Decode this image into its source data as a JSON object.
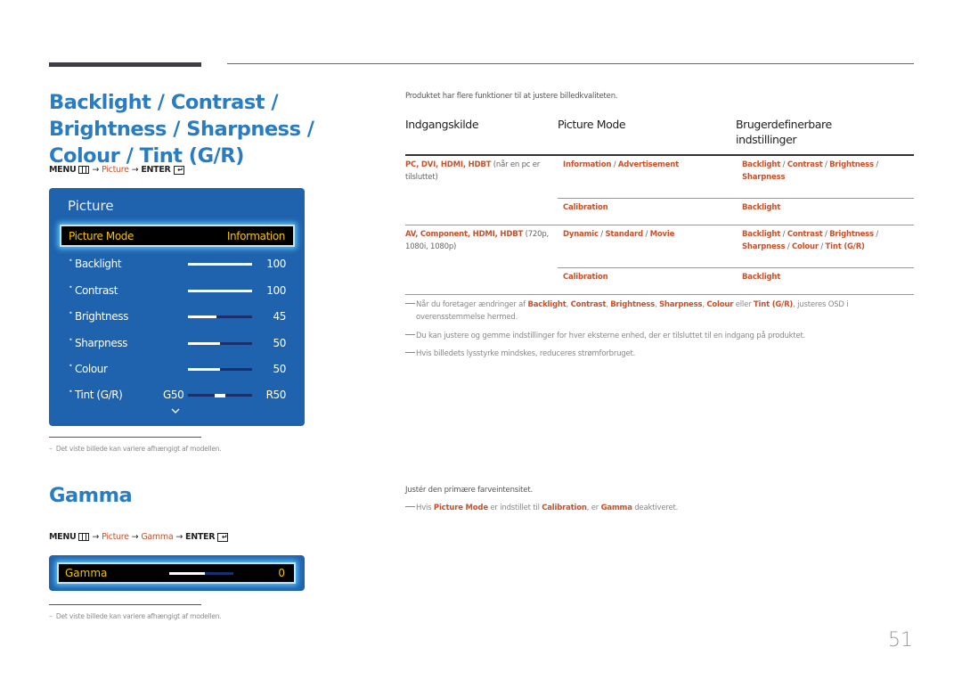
{
  "section1": {
    "title": "Backlight / Contrast / Brightness / Sharpness / Colour / Tint (G/R)",
    "menu_path": {
      "menu": "MENU",
      "arrow": "→",
      "picture": "Picture",
      "enter": "ENTER"
    },
    "osd": {
      "title": "Picture",
      "selected_label": "Picture Mode",
      "selected_value": "Information",
      "rows": [
        {
          "label": "Backlight",
          "value": "100",
          "level": 1.0
        },
        {
          "label": "Contrast",
          "value": "100",
          "level": 1.0
        },
        {
          "label": "Brightness",
          "value": "45",
          "level": 0.45
        },
        {
          "label": "Sharpness",
          "value": "50",
          "level": 0.5
        },
        {
          "label": "Colour",
          "value": "50",
          "level": 0.5
        },
        {
          "label": "Tint (G/R)",
          "green_value": "G50",
          "value": "R50",
          "level": 0.5
        }
      ],
      "scroll_icon": "chevron-down-icon"
    },
    "footnote": "Det viste billede kan variere afhængigt af modellen.",
    "intro": "Produktet har flere funktioner til at justere billedkvaliteten.",
    "table": {
      "headers": [
        "Indgangskilde",
        "Picture Mode",
        "Brugerdefinerbare indstillinger"
      ],
      "rows": [
        {
          "source_bold": "PC, DVI, HDMI, HDBT",
          "source_plain": " (når en pc er tilsluttet)",
          "modes": [
            "Information",
            "Advertisement"
          ],
          "settings": [
            "Backlight",
            "Contrast",
            "Brightness",
            "Sharpness"
          ],
          "calibration_mode": "Calibration",
          "calibration_setting": "Backlight"
        },
        {
          "source_bold": "AV, Component, HDMI, HDBT",
          "source_plain": " (720p, 1080i, 1080p)",
          "modes": [
            "Dynamic",
            "Standard",
            "Movie"
          ],
          "settings": [
            "Backlight",
            "Contrast",
            "Brightness",
            "Sharpness",
            "Colour",
            "Tint (G/R)"
          ],
          "calibration_mode": "Calibration",
          "calibration_setting": "Backlight"
        }
      ]
    },
    "notes": {
      "n1_pre": "Når du foretager ændringer af ",
      "n1_terms": [
        "Backlight",
        "Contrast",
        "Brightness",
        "Sharpness",
        "Colour"
      ],
      "n1_or": " eller ",
      "n1_last": "Tint (G/R)",
      "n1_post": ", justeres OSD i",
      "n1_cont": "overensstemmelse hermed.",
      "n2": "Du kan justere og gemme indstillinger for hver eksterne enhed, der er tilsluttet til en indgang på produktet.",
      "n3": "Hvis billedets lysstyrke mindskes, reduceres strømforbruget."
    }
  },
  "section2": {
    "title": "Gamma",
    "menu_path": {
      "menu": "MENU",
      "arrow": "→",
      "picture": "Picture",
      "gamma": "Gamma",
      "enter": "ENTER"
    },
    "osd": {
      "label": "Gamma",
      "value": "0",
      "level": 0.55
    },
    "footnote": "Det viste billede kan variere afhængigt af modellen.",
    "description": "Justér den primære farveintensitet.",
    "note": {
      "pre": "Hvis ",
      "term1": "Picture Mode",
      "mid1": " er indstillet til ",
      "term2": "Calibration",
      "mid2": ", er ",
      "term3": "Gamma",
      "post": " deaktiveret."
    }
  },
  "page_number": "51",
  "colors": {
    "heading_blue": "#2a7cc2",
    "link_orange": "#c8502a",
    "osd_blue": "#1f62ad",
    "osd_highlight_text": "#f2c200"
  }
}
